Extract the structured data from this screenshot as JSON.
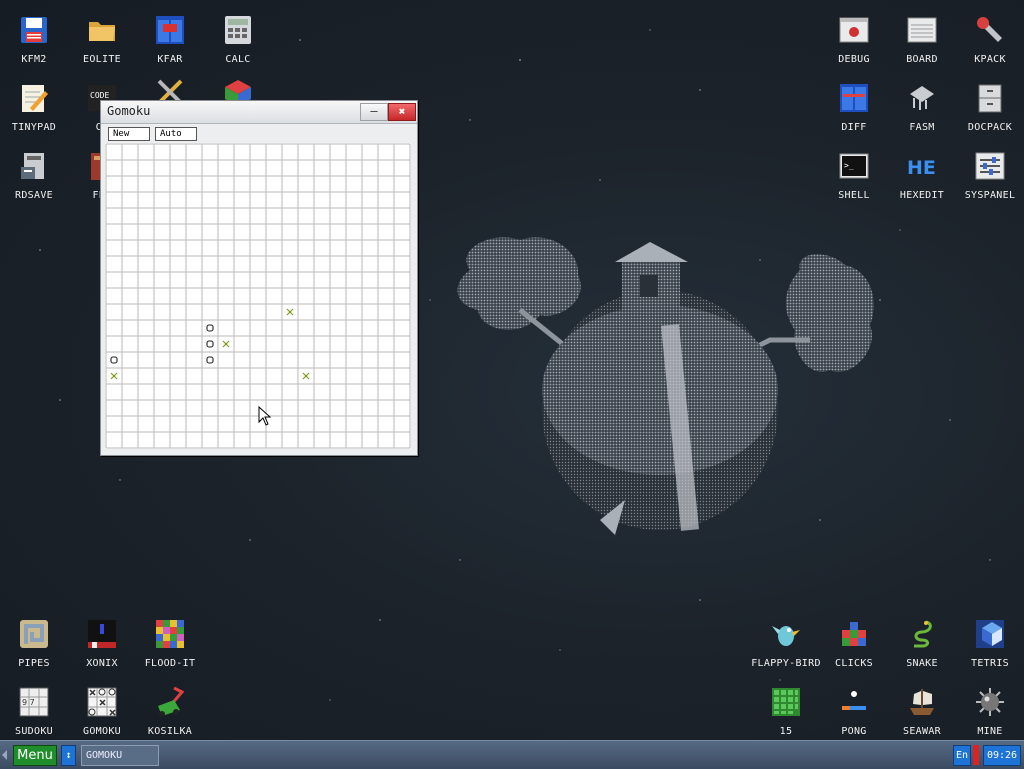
{
  "desktop": {
    "icons": [
      {
        "label": "KFM2",
        "icon": "floppy-disk-icon"
      },
      {
        "label": "EOLITE",
        "icon": "folder-icon"
      },
      {
        "label": "KFAR",
        "icon": "file-manager-icon"
      },
      {
        "label": "CALC",
        "icon": "calculator-icon"
      },
      {
        "label": "TINYPAD",
        "icon": "notepad-pencil-icon"
      },
      {
        "label": "CE",
        "icon": "code-editor-icon"
      },
      {
        "label": "",
        "icon": "tools-icon"
      },
      {
        "label": "",
        "icon": "cube-icon"
      },
      {
        "label": "RDSAVE",
        "icon": "ramdisk-save-icon"
      },
      {
        "label": "FB2",
        "icon": "book-icon"
      },
      {
        "label": "DEBUG",
        "icon": "debug-bug-icon"
      },
      {
        "label": "BOARD",
        "icon": "board-icon"
      },
      {
        "label": "KPACK",
        "icon": "wrench-icon"
      },
      {
        "label": "DIFF",
        "icon": "diff-icon"
      },
      {
        "label": "FASM",
        "icon": "fasm-icon"
      },
      {
        "label": "DOCPACK",
        "icon": "cabinet-icon"
      },
      {
        "label": "SHELL",
        "icon": "terminal-icon"
      },
      {
        "label": "HEXEDIT",
        "icon": "hex-icon"
      },
      {
        "label": "SYSPANEL",
        "icon": "sliders-icon"
      },
      {
        "label": "PIPES",
        "icon": "pipes-icon"
      },
      {
        "label": "XONIX",
        "icon": "xonix-icon"
      },
      {
        "label": "FLOOD-IT",
        "icon": "flood-it-icon"
      },
      {
        "label": "SUDOKU",
        "icon": "sudoku-icon"
      },
      {
        "label": "GOMOKU",
        "icon": "gomoku-icon"
      },
      {
        "label": "KOSILKA",
        "icon": "lawnmower-icon"
      },
      {
        "label": "FLAPPY-BIRD",
        "icon": "bird-icon"
      },
      {
        "label": "CLICKS",
        "icon": "blocks-icon"
      },
      {
        "label": "SNAKE",
        "icon": "snake-icon"
      },
      {
        "label": "TETRIS",
        "icon": "tetris-icon"
      },
      {
        "label": "15",
        "icon": "fifteen-icon"
      },
      {
        "label": "PONG",
        "icon": "pong-icon"
      },
      {
        "label": "SEAWAR",
        "icon": "ship-icon"
      },
      {
        "label": "MINE",
        "icon": "mine-icon"
      }
    ]
  },
  "window": {
    "title": "Gomoku",
    "minimize_label": "–",
    "close_label": "✖",
    "toolbar": {
      "new_label": "New",
      "auto_label": "Auto"
    },
    "board": {
      "size": 19,
      "stones": [
        {
          "col": 11,
          "row": 10,
          "type": "x"
        },
        {
          "col": 6,
          "row": 11,
          "type": "o"
        },
        {
          "col": 6,
          "row": 12,
          "type": "o"
        },
        {
          "col": 7,
          "row": 12,
          "type": "x"
        },
        {
          "col": 0,
          "row": 13,
          "type": "o"
        },
        {
          "col": 6,
          "row": 13,
          "type": "o"
        },
        {
          "col": 0,
          "row": 14,
          "type": "x"
        },
        {
          "col": 12,
          "row": 14,
          "type": "x"
        }
      ],
      "colors": {
        "x": "#7a9a1c",
        "o": "#222222",
        "grid": "#b8b8b8"
      }
    }
  },
  "taskbar": {
    "menu_label": "Menu",
    "switch_label": "↕",
    "task_label": "GOMOKU",
    "lang_label": "En",
    "clock": "09:26"
  }
}
